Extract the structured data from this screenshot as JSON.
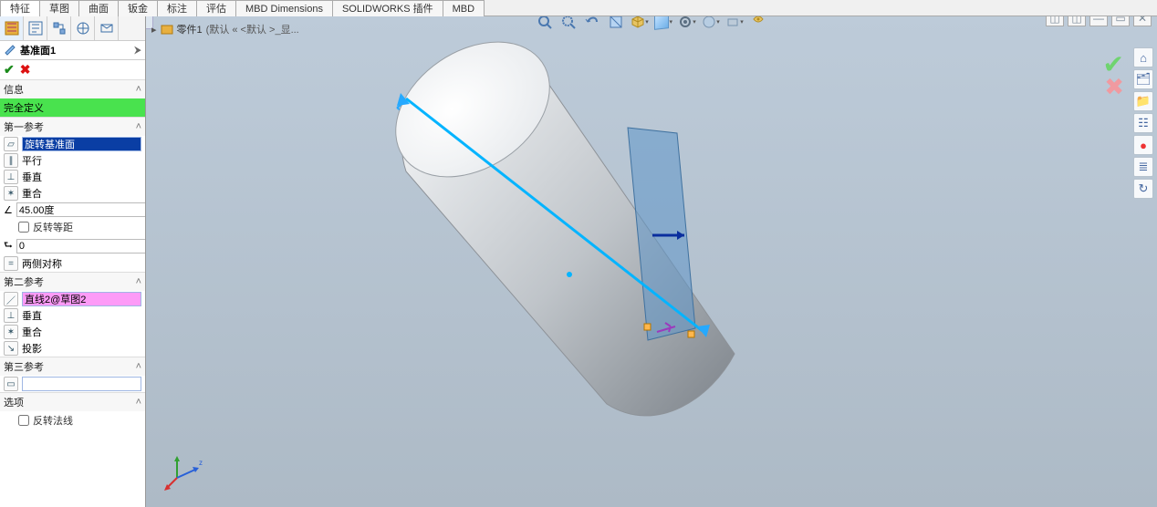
{
  "tabs": [
    "特征",
    "草图",
    "曲面",
    "钣金",
    "标注",
    "评估",
    "MBD Dimensions",
    "SOLIDWORKS 插件",
    "MBD"
  ],
  "active_tab": 0,
  "breadcrumb": {
    "arrow": "▸",
    "part": "零件1",
    "state": "(默认 « <默认 >_显..."
  },
  "pm": {
    "title": "基准面1",
    "info_hdr": "信息",
    "status": "完全定义",
    "ref1_hdr": "第一参考",
    "ref1_sel": "旋转基准面",
    "ref1_opts": {
      "parallel": "平行",
      "perp": "垂直",
      "coincident": "重合"
    },
    "angle": "45.00度",
    "reverse_equal": "反转等距",
    "count": "0",
    "mid": "两侧对称",
    "ref2_hdr": "第二参考",
    "ref2_sel": "直线2@草图2",
    "ref2_opts": {
      "perp": "垂直",
      "coincident": "重合",
      "project": "投影"
    },
    "ref3_hdr": "第三参考",
    "options_hdr": "选项",
    "reverse_normal": "反转法线"
  },
  "icons": {
    "plane": "◇",
    "parallel": "∥",
    "perp": "⊥",
    "coin": "✶",
    "angle": "∠",
    "count": "⮑",
    "mid": "=",
    "project": "↘",
    "search": "🔍",
    "zoomfit": "⤢",
    "section": "✂",
    "view": "◫",
    "display": "◐",
    "scene": "●",
    "screen": "▭",
    "help": "?",
    "rot": "⟳",
    "orient": "▦",
    "hide": "◎",
    "home": "⌂",
    "lib": "🗂",
    "folder": "📁",
    "props": "☷",
    "appear": "🔴",
    "cfg": "≣",
    "reload": "↻",
    "planeico": "▱"
  }
}
